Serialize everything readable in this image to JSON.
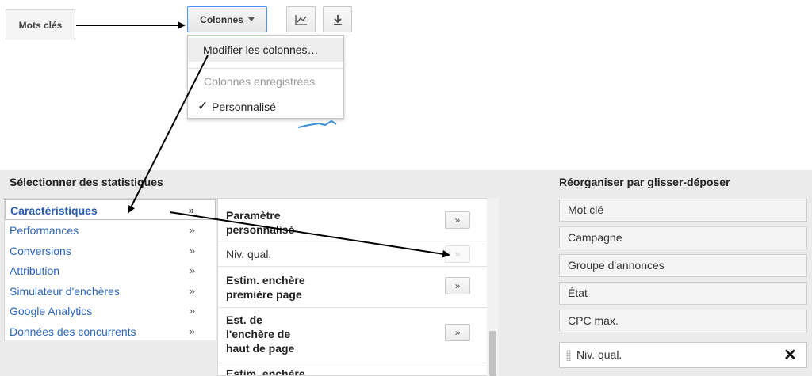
{
  "toolbar": {
    "tab_label": "Mots clés",
    "columns_button_label": "Colonnes"
  },
  "dropdown": {
    "modify_columns": "Modifier les colonnes…",
    "saved_columns_header": "Colonnes enregistrées",
    "checkmark": "✓",
    "custom": "Personnalisé"
  },
  "select_stats": {
    "title": "Sélectionner des statistiques",
    "chevron": "»",
    "categories": [
      {
        "label": "Caractéristiques",
        "active": true
      },
      {
        "label": "Performances"
      },
      {
        "label": "Conversions"
      },
      {
        "label": "Attribution"
      },
      {
        "label": "Simulateur d'enchères"
      },
      {
        "label": "Google Analytics"
      },
      {
        "label": "Données des concurrents"
      }
    ],
    "metrics": [
      {
        "line1": "Paramètre",
        "line2": "personnalisé"
      },
      {
        "line1": "Niv. qual."
      },
      {
        "line1": "Estim. enchère",
        "line2": "première page"
      },
      {
        "line1": "Est. de",
        "line2": "l'enchère de",
        "line3": "haut de page"
      },
      {
        "line1": "Estim. enchère"
      }
    ],
    "add_label": "»"
  },
  "reorganize": {
    "title": "Réorganiser par glisser-déposer",
    "columns": [
      "Mot clé",
      "Campagne",
      "Groupe d'annonces",
      "État",
      "CPC max."
    ],
    "added_column": "Niv. qual.",
    "remove_label": "✕"
  }
}
